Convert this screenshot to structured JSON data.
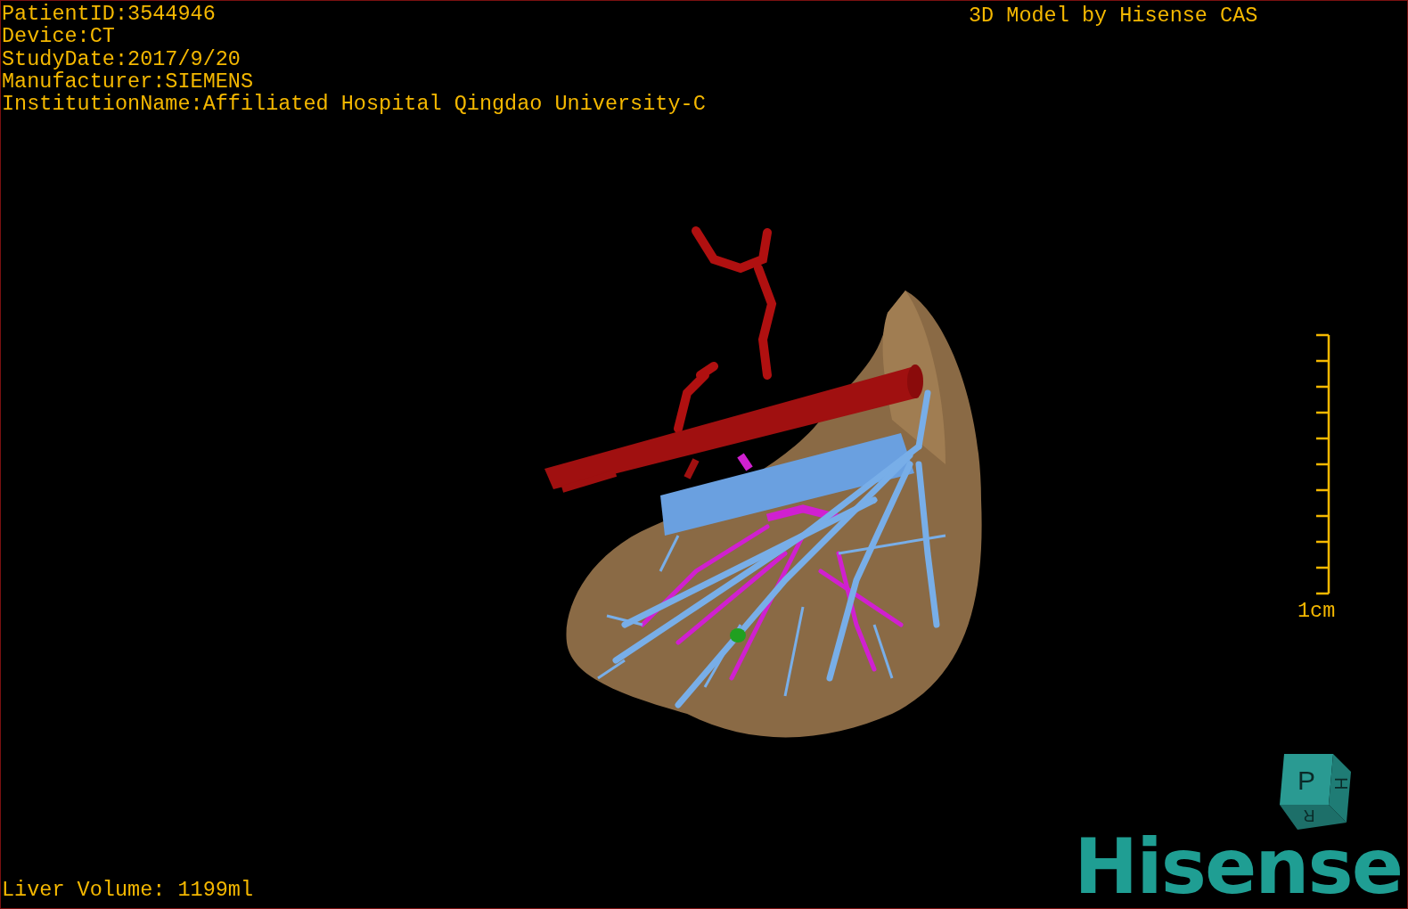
{
  "info_lines": [
    "PatientID:3544946",
    "Device:CT",
    "StudyDate:2017/9/20",
    "Manufacturer:SIEMENS",
    "InstitutionName:Affiliated Hospital Qingdao University-C"
  ],
  "title": "3D Model by Hisense CAS",
  "scale": {
    "label": "1cm"
  },
  "liver_volume": "Liver Volume: 1199ml",
  "orientation_cube": {
    "faces": [
      "P",
      "H",
      "R"
    ]
  },
  "logo": "Hisense"
}
